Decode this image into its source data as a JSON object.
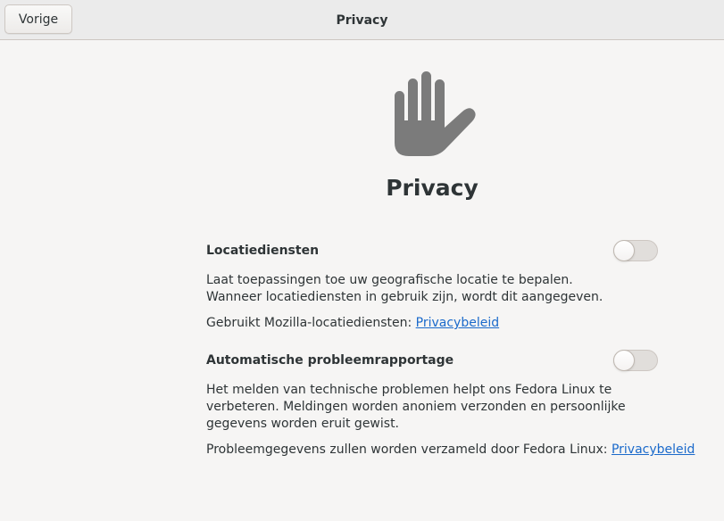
{
  "header": {
    "back_label": "Vorige",
    "title": "Privacy"
  },
  "page": {
    "title": "Privacy",
    "icon": "raised-hand-icon"
  },
  "location": {
    "heading": "Locatiediensten",
    "enabled": false,
    "description": "Laat toepassingen toe uw geografische locatie te bepalen. Wanneer locatiediensten in gebruik zijn, wordt dit aangegeven.",
    "note_prefix": "Gebruikt Mozilla-locatiediensten: ",
    "link_label": "Privacybeleid"
  },
  "reporting": {
    "heading": "Automatische probleemrapportage",
    "enabled": false,
    "description": "Het melden van technische problemen helpt ons Fedora Linux te verbeteren. Meldingen worden anoniem verzonden en persoonlijke gegevens worden eruit gewist.",
    "note_prefix": "Probleemgegevens zullen worden verzameld door Fedora Linux: ",
    "link_label": "Privacybeleid"
  },
  "colors": {
    "link": "#1b6acb",
    "icon": "#7b7b7b",
    "background": "#f6f5f4"
  }
}
